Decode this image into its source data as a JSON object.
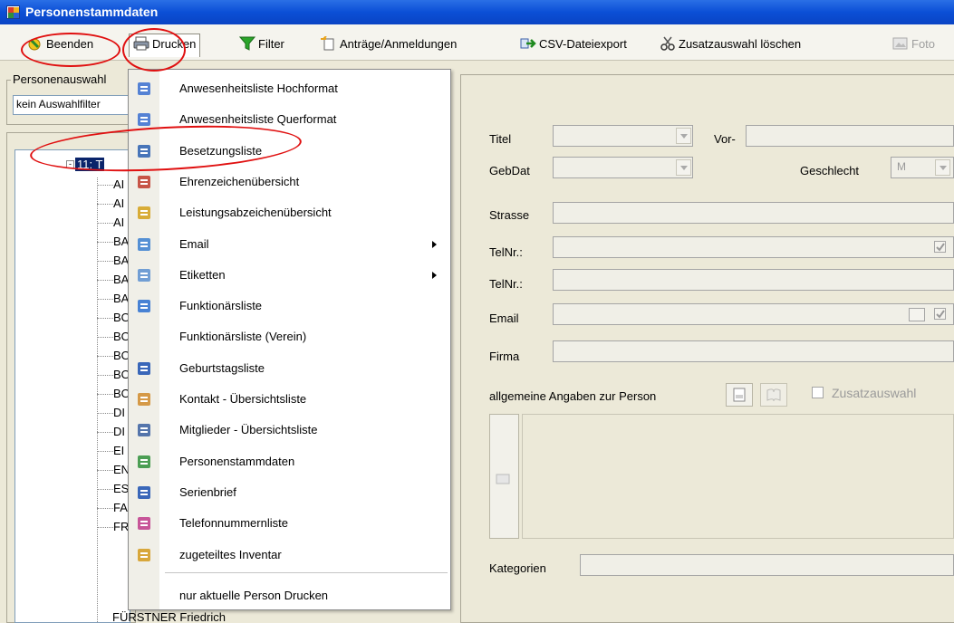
{
  "window": {
    "title": "Personenstammdaten"
  },
  "toolbar": {
    "beenden": "Beenden",
    "drucken": "Drucken",
    "filter": "Filter",
    "antraege": "Anträge/Anmeldungen",
    "csv": "CSV-Dateiexport",
    "zusatz": "Zusatzauswahl löschen",
    "foto": "Foto"
  },
  "left": {
    "group_label": "Personenauswahl",
    "filter_value": "kein Auswahlfilter",
    "tree_node": "11: T",
    "items": [
      "AI",
      "AI",
      "AI",
      "BA",
      "BA",
      "BA",
      "BA",
      "BO",
      "BO",
      "BO",
      "BO",
      "BO",
      "DI",
      "DI",
      "EI",
      "EN",
      "ES",
      "FA",
      "FR"
    ],
    "bottom_item": "FÜRSTNER Friedrich"
  },
  "menu": {
    "items": [
      "Anwesenheitsliste Hochformat",
      "Anwesenheitsliste Querformat",
      "Besetzungsliste",
      "Ehrenzeichenübersicht",
      "Leistungsabzeichenübersicht",
      "Email",
      "Etiketten",
      "Funktionärsliste",
      "Funktionärsliste (Verein)",
      "Geburtstagsliste",
      "Kontakt - Übersichtsliste",
      "Mitglieder - Übersichtsliste",
      "Personenstammdaten",
      "Serienbrief",
      "Telefonnummernliste",
      "zugeteiltes Inventar"
    ],
    "last_item": "nur aktuelle Person Drucken"
  },
  "form": {
    "titel": "Titel",
    "vor": "Vor-",
    "gebdat": "GebDat",
    "geschlecht": "Geschlecht",
    "geschlecht_value": "M",
    "strasse": "Strasse",
    "telnr1": "TelNr.:",
    "telnr2": "TelNr.:",
    "email": "Email",
    "firma": "Firma",
    "allgemeine": "allgemeine Angaben zur Person",
    "zusatzauswahl": "Zusatzauswahl",
    "kategorien": "Kategorien"
  },
  "colors": {
    "highlight": "#e01010",
    "titlebar": "#0b4fd6",
    "selection": "#0a246a"
  }
}
